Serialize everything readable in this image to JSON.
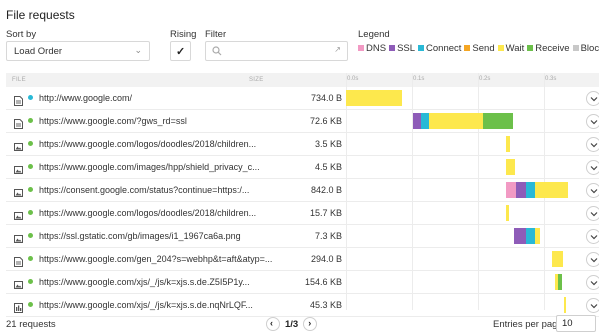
{
  "title": "File requests",
  "controls": {
    "sort_label": "Sort by",
    "sort_value": "Load Order",
    "rising_label": "Rising",
    "rising_checked": true,
    "filter_label": "Filter",
    "filter_placeholder": ""
  },
  "legend": {
    "title": "Legend",
    "items": [
      {
        "label": "DNS",
        "color": "#f29ac4"
      },
      {
        "label": "SSL",
        "color": "#8e5cb8"
      },
      {
        "label": "Connect",
        "color": "#29b9d6"
      },
      {
        "label": "Send",
        "color": "#f5a623"
      },
      {
        "label": "Wait",
        "color": "#fde84d"
      },
      {
        "label": "Receive",
        "color": "#6cc04a"
      },
      {
        "label": "Blocked",
        "color": "#c8c8c8"
      }
    ]
  },
  "table": {
    "col_file": "FILE",
    "col_size": "SIZE",
    "time_ticks": [
      "0.0s",
      "0.1s",
      "0.2s",
      "0.3s"
    ]
  },
  "rows": [
    {
      "type": "doc",
      "dot": "#29b9d6",
      "url": "http://www.google.com/",
      "size": "734.0 B",
      "timing": [
        {
          "phase": "Wait",
          "start": 0.0,
          "dur": 0.085
        }
      ]
    },
    {
      "type": "doc",
      "dot": "#6cc04a",
      "url": "https://www.google.com/?gws_rd=ssl",
      "size": "72.6 KB",
      "timing": [
        {
          "phase": "SSL",
          "start": 0.102,
          "dur": 0.012
        },
        {
          "phase": "Connect",
          "start": 0.114,
          "dur": 0.012
        },
        {
          "phase": "Wait",
          "start": 0.126,
          "dur": 0.082
        },
        {
          "phase": "Receive",
          "start": 0.208,
          "dur": 0.045
        }
      ]
    },
    {
      "type": "img",
      "dot": "#6cc04a",
      "url": "https://www.google.com/logos/doodles/2018/children...",
      "size": "3.5 KB",
      "timing": [
        {
          "phase": "Wait",
          "start": 0.242,
          "dur": 0.006
        }
      ]
    },
    {
      "type": "img",
      "dot": "#6cc04a",
      "url": "https://www.google.com/images/hpp/shield_privacy_c...",
      "size": "4.5 KB",
      "timing": [
        {
          "phase": "Wait",
          "start": 0.242,
          "dur": 0.014
        }
      ]
    },
    {
      "type": "img",
      "dot": "#6cc04a",
      "url": "https://consent.google.com/status?continue=https:/...",
      "size": "842.0 B",
      "timing": [
        {
          "phase": "DNS",
          "start": 0.242,
          "dur": 0.016
        },
        {
          "phase": "SSL",
          "start": 0.258,
          "dur": 0.014
        },
        {
          "phase": "Connect",
          "start": 0.272,
          "dur": 0.014
        },
        {
          "phase": "Wait",
          "start": 0.286,
          "dur": 0.05
        }
      ]
    },
    {
      "type": "img",
      "dot": "#6cc04a",
      "url": "https://www.google.com/logos/doodles/2018/children...",
      "size": "15.7 KB",
      "timing": [
        {
          "phase": "Wait",
          "start": 0.242,
          "dur": 0.005
        }
      ]
    },
    {
      "type": "img",
      "dot": "#6cc04a",
      "url": "https://ssl.gstatic.com/gb/images/i1_1967ca6a.png",
      "size": "7.3 KB",
      "timing": [
        {
          "phase": "SSL",
          "start": 0.255,
          "dur": 0.018
        },
        {
          "phase": "Connect",
          "start": 0.273,
          "dur": 0.014
        },
        {
          "phase": "Wait",
          "start": 0.287,
          "dur": 0.007
        }
      ]
    },
    {
      "type": "doc",
      "dot": "#6cc04a",
      "url": "https://www.google.com/gen_204?s=webhp&t=aft&atyp=...",
      "size": "294.0 B",
      "timing": [
        {
          "phase": "Wait",
          "start": 0.312,
          "dur": 0.017
        }
      ]
    },
    {
      "type": "img",
      "dot": "#6cc04a",
      "url": "https://www.google.com/xjs/_/js/k=xjs.s.de.Z5I5P1y...",
      "size": "154.6 KB",
      "timing": [
        {
          "phase": "Wait",
          "start": 0.316,
          "dur": 0.005
        },
        {
          "phase": "Receive",
          "start": 0.321,
          "dur": 0.007
        }
      ]
    },
    {
      "type": "xls",
      "dot": "#6cc04a",
      "url": "https://www.google.com/xjs/_/js/k=xjs.s.de.nqNrLQF...",
      "size": "45.3 KB",
      "timing": [
        {
          "phase": "Wait",
          "start": 0.331,
          "dur": 0.002
        }
      ]
    }
  ],
  "footer": {
    "count": "21 requests",
    "page": "1/3",
    "entries_label": "Entries per page:",
    "entries_value": "10"
  }
}
